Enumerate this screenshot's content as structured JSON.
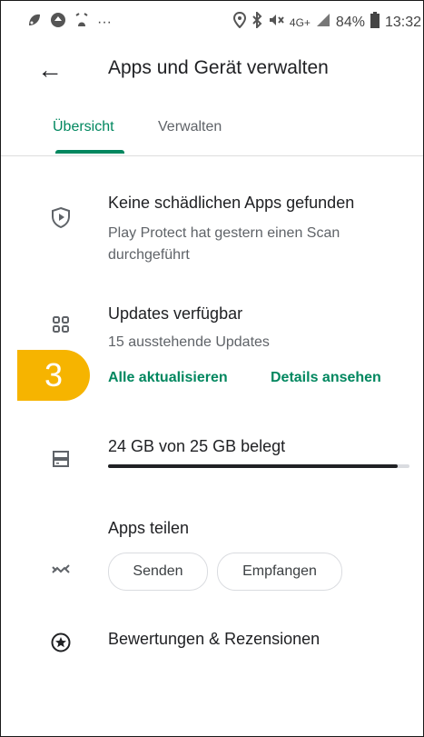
{
  "status_bar": {
    "left_icons": [
      "settings-leaf-icon",
      "drive-icon",
      "alarm-clock-icon"
    ],
    "overflow": "···",
    "network_label": "4G+",
    "battery_percent": "84%",
    "time": "13:32"
  },
  "app_bar": {
    "back_glyph": "←",
    "title": "Apps und Gerät verwalten"
  },
  "tabs": [
    {
      "label": "Übersicht",
      "active": true
    },
    {
      "label": "Verwalten",
      "active": false
    }
  ],
  "play_protect": {
    "title": "Keine schädlichen Apps gefunden",
    "subtitle": "Play Protect hat gestern einen Scan durchgeführt"
  },
  "updates": {
    "title": "Updates verfügbar",
    "subtitle": "15 ausstehende Updates",
    "update_all_label": "Alle aktualisieren",
    "details_label": "Details ansehen",
    "annotation_badge": "3"
  },
  "storage": {
    "label": "24 GB von 25 GB belegt",
    "used_fraction": 0.96
  },
  "share": {
    "title": "Apps teilen",
    "send_label": "Senden",
    "receive_label": "Empfangen"
  },
  "ratings": {
    "title": "Bewertungen & Rezensionen"
  },
  "colors": {
    "accent": "#01875f",
    "badge": "#f6b400",
    "text_primary": "#202124",
    "text_secondary": "#5f6368"
  }
}
